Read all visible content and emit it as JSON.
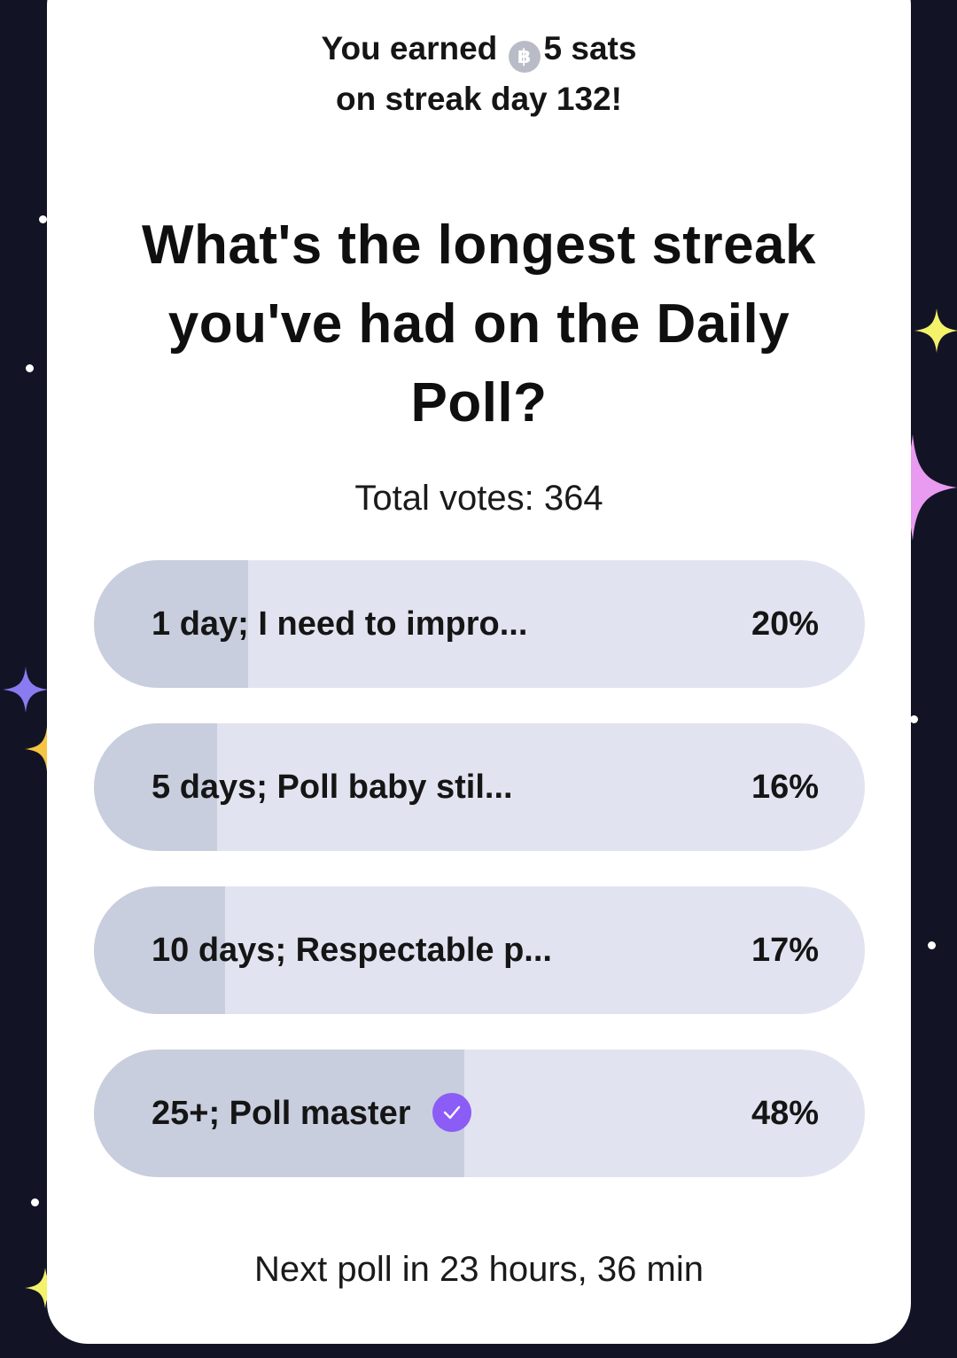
{
  "reward": {
    "line1_prefix": "You earned",
    "sat_icon": "bitcoin-coin-icon",
    "line1_amount": "5 sats",
    "line2": "on streak day 132!"
  },
  "poll": {
    "question": "What's the longest streak you've had on the Daily Poll?",
    "total_votes": "Total votes: 364",
    "options": [
      {
        "label": "1 day; I need to impro...",
        "percent": "20%",
        "fill_fraction": 0.2,
        "selected": false
      },
      {
        "label": "5 days; Poll baby stil...",
        "percent": "16%",
        "fill_fraction": 0.16,
        "selected": false
      },
      {
        "label": "10 days; Respectable p...",
        "percent": "17%",
        "fill_fraction": 0.17,
        "selected": false
      },
      {
        "label": "25+; Poll master",
        "percent": "48%",
        "fill_fraction": 0.48,
        "selected": true
      }
    ],
    "next_poll": "Next poll in 23 hours, 36 min"
  },
  "colors": {
    "background": "#121426",
    "card": "#ffffff",
    "option_track": "#e1e4f0",
    "option_fill": "#c8cedd",
    "check_accent": "#8b5cf6",
    "sparkle_purple": "#8a7cf0",
    "sparkle_yellow": "#f5c542",
    "sparkle_pink": "#e89bf0",
    "sparkle_lime": "#f3f26a"
  }
}
